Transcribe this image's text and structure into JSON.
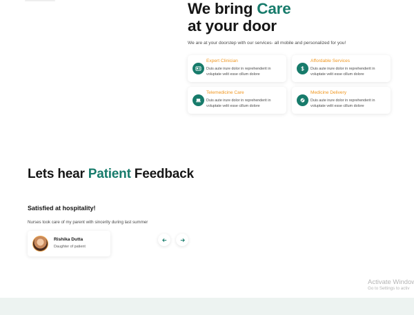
{
  "hero": {
    "title_prefix": "We bring ",
    "title_accent": "Care",
    "title_line2": "at your door",
    "subtitle": "We are at your doorstep with our services- all mobile and personalized for you!"
  },
  "services": [
    {
      "title": "Expert Clinician",
      "desc": "Duis aute irure dolor in reprehenderit in voluptate velit esse cillum dolore",
      "icon": "id-card-icon"
    },
    {
      "title": "Affordable Services",
      "desc": "Duis aute irure dolor in reprehenderit in voluptate velit esse cillum dolore",
      "icon": "dollar-icon"
    },
    {
      "title": "Telemedicine Care",
      "desc": "Duis aute irure dolor in reprehenderit in voluptate velit esse cillum dolore",
      "icon": "laptop-icon"
    },
    {
      "title": "Medicine Delivery",
      "desc": "Duis aute irure dolor in reprehenderit in voluptate velit esse cillum dolore",
      "icon": "pill-icon"
    }
  ],
  "feedback": {
    "title_prefix": "Lets hear ",
    "title_accent": "Patient",
    "title_suffix": " Feedback",
    "headline": "Satisfied at hospitality!",
    "text": "Nurses took care of my parent with sincerity during last summer",
    "person": {
      "name": "Rishika Dutta",
      "role": "Daughter of patient"
    }
  },
  "windows_watermark": {
    "title": "Activate Window",
    "subtitle": "Go to Settings to activ"
  },
  "colors": {
    "accent": "#177b6b",
    "service_title": "#f0961e",
    "footer_band": "#edf3f1"
  }
}
